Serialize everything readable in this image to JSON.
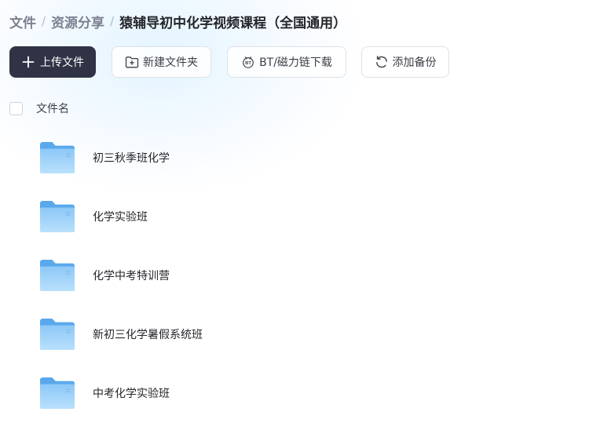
{
  "breadcrumb": {
    "items": [
      {
        "label": "文件"
      },
      {
        "label": "资源分享"
      },
      {
        "label": "猿辅导初中化学视频课程（全国通用）"
      }
    ],
    "separator": "/"
  },
  "toolbar": {
    "upload_label": "上传文件",
    "new_folder_label": "新建文件夹",
    "bt_label": "BT/磁力链下载",
    "backup_label": "添加备份"
  },
  "list": {
    "header": "文件名",
    "rows": [
      {
        "name": "初三秋季班化学",
        "icon": "folder-icon"
      },
      {
        "name": "化学实验班",
        "icon": "folder-icon"
      },
      {
        "name": "化学中考特训营",
        "icon": "folder-icon"
      },
      {
        "name": "新初三化学暑假系统班",
        "icon": "folder-icon"
      },
      {
        "name": "中考化学实验班",
        "icon": "folder-icon"
      }
    ]
  },
  "colors": {
    "primary_button": "#2f3345",
    "folder_blue": "#6cb6f2",
    "text": "#25262b",
    "muted": "#7d8190"
  }
}
